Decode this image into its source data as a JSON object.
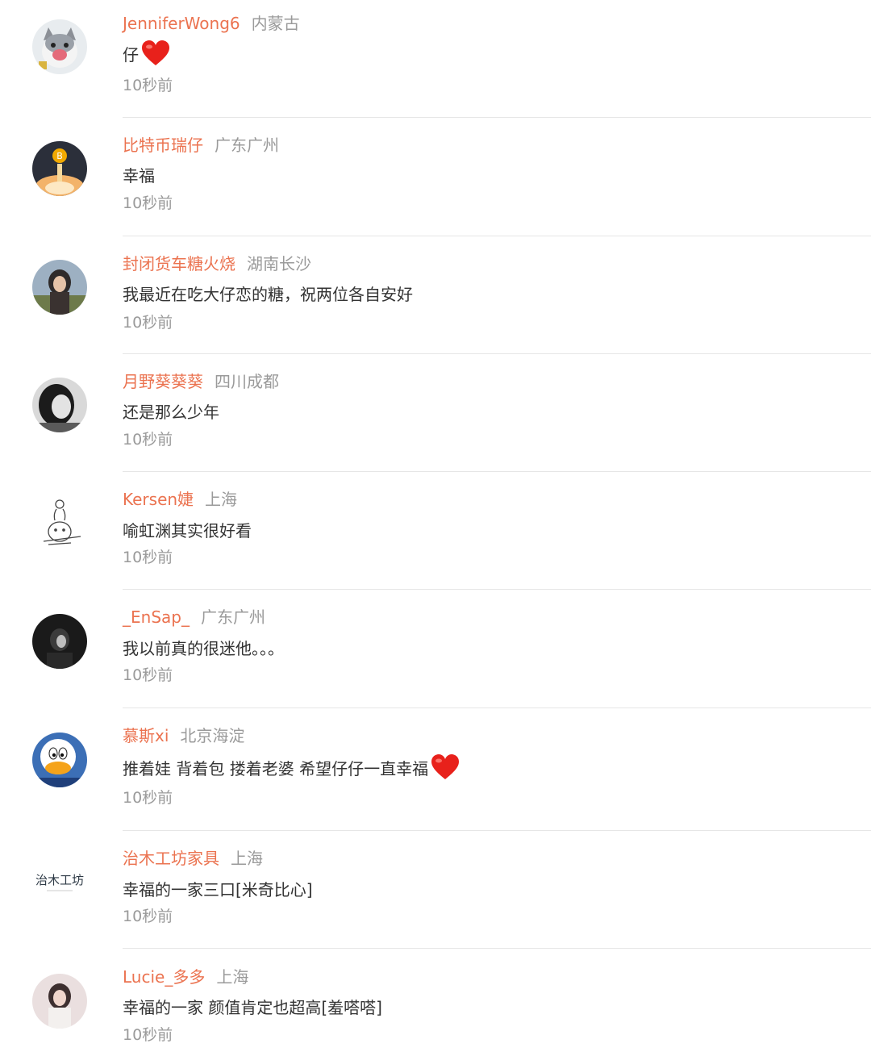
{
  "comments": [
    {
      "username": "JenniferWong6",
      "location": "内蒙古",
      "text": "仔",
      "emoji": "heart-emoji",
      "time": "10秒前"
    },
    {
      "username": "比特币瑞仔",
      "location": "广东广州",
      "text": "幸福",
      "emoji": "",
      "time": "10秒前"
    },
    {
      "username": "封闭货车糖火烧",
      "location": "湖南长沙",
      "text": "我最近在吃大仔恋的糖，祝两位各自安好",
      "emoji": "",
      "time": "10秒前"
    },
    {
      "username": "月野葵葵葵",
      "location": "四川成都",
      "text": "还是那么少年",
      "emoji": "",
      "time": "10秒前"
    },
    {
      "username": "Kersen婕",
      "location": "上海",
      "text": "喻虹渊其实很好看",
      "emoji": "",
      "time": "10秒前"
    },
    {
      "username": "_EnSap_",
      "location": "广东广州",
      "text": "我以前真的很迷他。。。",
      "emoji": "",
      "time": "10秒前"
    },
    {
      "username": "慕斯xi",
      "location": "北京海淀",
      "text": "推着娃 背着包 搂着老婆 希望仔仔一直幸福",
      "emoji": "heart-emoji",
      "time": "10秒前"
    },
    {
      "username": "治木工坊家具",
      "location": "上海",
      "text": "幸福的一家三口[米奇比心]",
      "emoji": "",
      "time": "10秒前"
    },
    {
      "username": "Lucie_多多",
      "location": "上海",
      "text": "幸福的一家 颜值肯定也超高[羞嗒嗒]",
      "emoji": "",
      "time": "10秒前"
    }
  ],
  "avatars": [
    {
      "name": "cat-avatar",
      "bg": "#dfe3e6"
    },
    {
      "name": "bitcoin-rocket-avatar",
      "bg": "#2b2f3a"
    },
    {
      "name": "girl-portrait-avatar",
      "bg": "#9aa8b6"
    },
    {
      "name": "bw-portrait-avatar",
      "bg": "#555555"
    },
    {
      "name": "sketch-bunny-avatar",
      "bg": "#ffffff"
    },
    {
      "name": "dark-portrait-avatar",
      "bg": "#1d1d1d"
    },
    {
      "name": "donald-duck-avatar",
      "bg": "#3c6fb6"
    },
    {
      "name": "zhimu-logo-avatar",
      "bg": "#ffffff",
      "logo_text": "治木工坊"
    },
    {
      "name": "girl-pink-avatar",
      "bg": "#e9dede"
    }
  ],
  "colors": {
    "username": "#eb7350",
    "location": "#9a9a9a",
    "comment": "#333333",
    "time": "#9a9a9a",
    "divider": "#e6e6e6",
    "heart": "#e8211b"
  }
}
